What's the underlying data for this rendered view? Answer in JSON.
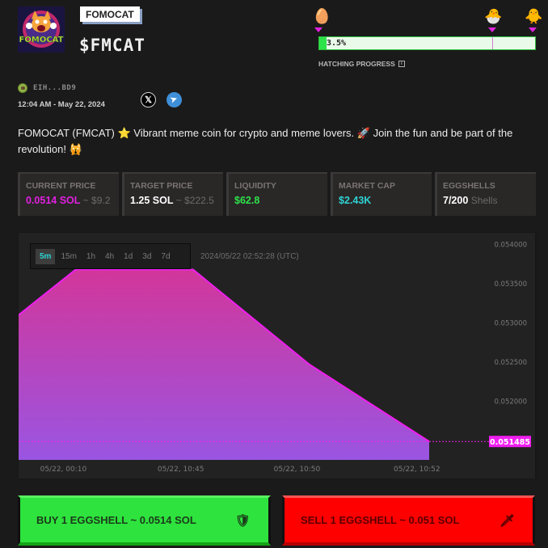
{
  "token": {
    "name": "FOMOCAT",
    "ticker": "$FMCAT",
    "logo_text": "FOMOCAT",
    "creator_address": "EIH...BD9",
    "created_at": "12:04 AM - May 22, 2024",
    "description": "FOMOCAT (FMCAT) ⭐ Vibrant meme coin for crypto and meme lovers. 🚀 Join the fun and be part of the revolution! 🙀"
  },
  "social": {
    "x_icon": "x-logo-icon",
    "telegram_icon": "telegram-icon",
    "x_glyph": "𝕏",
    "telegram_glyph": "➤"
  },
  "hatching": {
    "label": "HATCHING PROGRESS",
    "info_glyph": "i",
    "progress_text": "3.5%",
    "progress_percent": 3.5,
    "stages": [
      {
        "name": "egg",
        "glyph": "🥚",
        "position_percent": 0
      },
      {
        "name": "hatching-chick",
        "glyph": "🐣",
        "position_percent": 80
      },
      {
        "name": "chick",
        "glyph": "🐥",
        "position_percent": 100
      }
    ],
    "accent_fill": "#2ee24a",
    "marker_color": "#e020e0"
  },
  "stats": [
    {
      "label": "CURRENT PRICE",
      "value": "0.0514 SOL",
      "sub": "~ $9.2",
      "color": "#e020e0"
    },
    {
      "label": "TARGET PRICE",
      "value": "1.25 SOL",
      "sub": "~ $222.5",
      "color": "#ffffff"
    },
    {
      "label": "LIQUIDITY",
      "value": "$62.8",
      "sub": "",
      "color": "#2ee24a"
    },
    {
      "label": "MARKET CAP",
      "value": "$2.43K",
      "sub": "",
      "color": "#2ed3d3"
    },
    {
      "label": "EGGSHELLS",
      "value": "7/200",
      "sub": "Shells",
      "color": "#ffffff"
    }
  ],
  "chart": {
    "timeframes": [
      "5m",
      "15m",
      "1h",
      "4h",
      "1d",
      "3d",
      "7d"
    ],
    "active_timeframe": "5m",
    "timestamp": "2024/05/22 02:52:28 (UTC)"
  },
  "chart_data": {
    "type": "area",
    "title": "",
    "xlabel": "",
    "ylabel": "",
    "x_tick_labels": [
      "05/22, 00:10",
      "05/22, 10:45",
      "05/22, 10:50",
      "05/22, 10:52"
    ],
    "y_tick_labels": [
      "0.054000",
      "0.053500",
      "0.053000",
      "0.052500",
      "0.052000"
    ],
    "y_ticks": [
      0.054,
      0.0535,
      0.053,
      0.0525,
      0.052
    ],
    "ylim": [
      0.05125,
      0.05415
    ],
    "points": [
      {
        "x": 0,
        "y": 0.0531
      },
      {
        "x": 0.139,
        "y": 0.05368
      },
      {
        "x": 0.425,
        "y": 0.05368
      },
      {
        "x": 0.708,
        "y": 0.05247
      },
      {
        "x": 1.0,
        "y": 0.051485
      }
    ],
    "last_price_label": "0.051485",
    "last_price": 0.051485,
    "line_color": "#f01ef0",
    "fill_top": "#d2369a",
    "fill_bottom": "#9a55e2",
    "grid": false
  },
  "actions": {
    "buy_label": "BUY 1 EGGSHELL ~ 0.0514 SOL",
    "buy_icon": "🛡",
    "sell_label": "SELL 1 EGGSHELL ~ 0.051 SOL",
    "sell_icon": "🗡"
  }
}
